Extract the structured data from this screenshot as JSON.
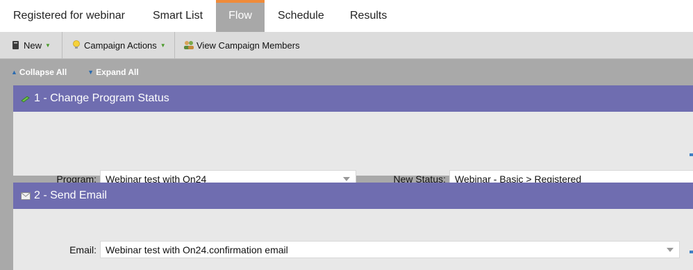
{
  "tabs": [
    {
      "label": "Registered for webinar"
    },
    {
      "label": "Smart List"
    },
    {
      "label": "Flow"
    },
    {
      "label": "Schedule"
    },
    {
      "label": "Results"
    }
  ],
  "toolbar": {
    "new_label": "New",
    "campaign_actions_label": "Campaign Actions",
    "view_members_label": "View Campaign Members"
  },
  "controls": {
    "collapse_label": "Collapse All",
    "expand_label": "Expand All"
  },
  "steps": [
    {
      "title": "1 - Change Program Status",
      "icon": "program-status-icon",
      "fields": [
        {
          "label": "Program:",
          "value": "Webinar test with On24"
        },
        {
          "label": "New Status:",
          "value": "Webinar - Basic > Registered"
        }
      ]
    },
    {
      "title": "2 - Send Email",
      "icon": "email-icon",
      "fields": [
        {
          "label": "Email:",
          "value": "Webinar test with On24.confirmation email"
        }
      ]
    }
  ],
  "colors": {
    "accent_tab": "#ef8b3a",
    "step_header": "#6f6db0",
    "toolbar_bg": "#dcdcdc",
    "canvas_bg": "#a9a9a9"
  }
}
